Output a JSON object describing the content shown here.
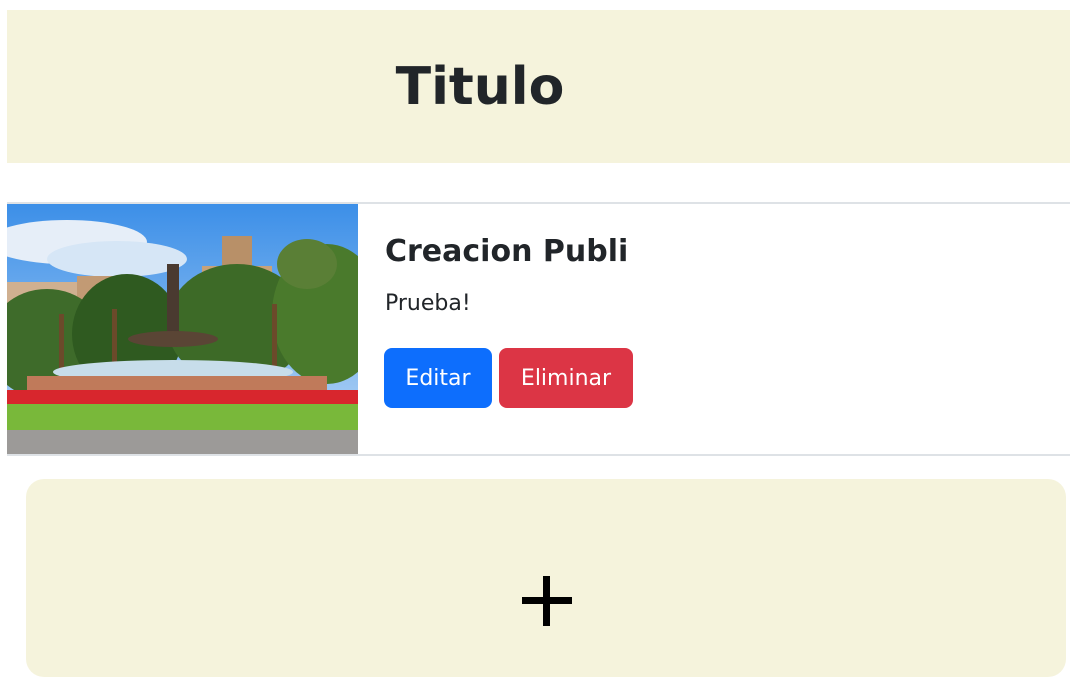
{
  "header": {
    "title": "Titulo"
  },
  "card": {
    "image_alt": "Fountain in a garden with palm trees and a fortress on the hill",
    "title": "Creacion Publi",
    "text": "Prueba!",
    "edit_label": "Editar",
    "delete_label": "Eliminar"
  },
  "add_panel": {
    "icon": "plus-icon"
  },
  "colors": {
    "panel_bg": "#f5f3dc",
    "edit_button": "#0d6efd",
    "delete_button": "#dc3545",
    "text": "#212529"
  }
}
